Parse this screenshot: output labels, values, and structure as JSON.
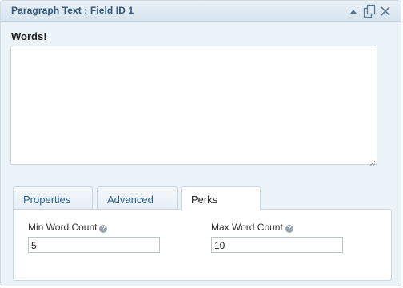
{
  "header": {
    "title": "Paragraph Text : Field ID 1",
    "icons": [
      "collapse-arrow-icon",
      "duplicate-icon",
      "delete-icon"
    ]
  },
  "field": {
    "label": "Words!",
    "value": ""
  },
  "tabs": [
    {
      "label": "Properties",
      "active": false
    },
    {
      "label": "Advanced",
      "active": false
    },
    {
      "label": "Perks",
      "active": true
    }
  ],
  "perks": {
    "min_label": "Min Word Count",
    "min_value": "5",
    "max_label": "Max Word Count",
    "max_value": "10",
    "help_glyph": "?"
  },
  "colors": {
    "header_text": "#35597a",
    "panel_bg": "#ebf3f9",
    "tab_text": "#2a6496",
    "border": "#c8d6e1"
  }
}
